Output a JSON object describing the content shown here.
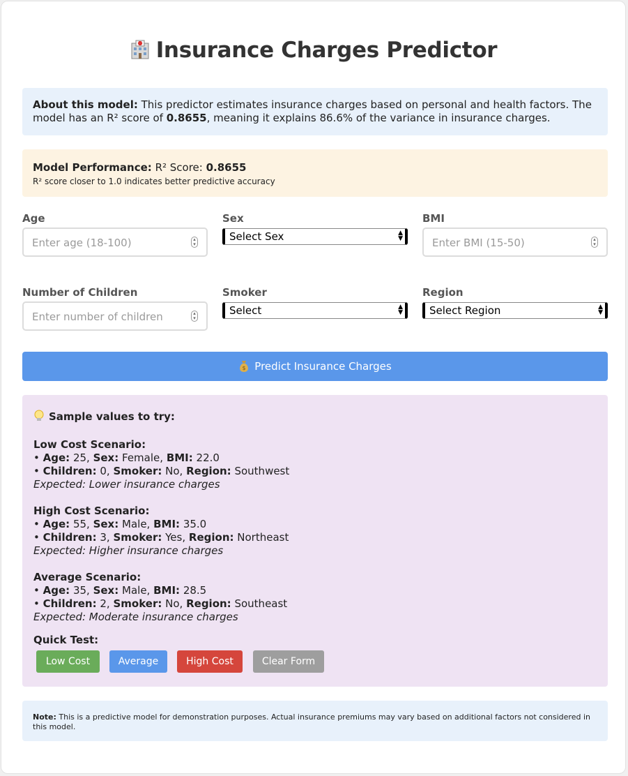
{
  "title": "Insurance Charges Predictor",
  "about": {
    "label": "About this model:",
    "text_1": " This predictor estimates insurance charges based on personal and health factors. The model has an R² score of ",
    "score": "0.8655",
    "text_2": ", meaning it explains 86.6% of the variance in insurance charges."
  },
  "performance": {
    "label": "Model Performance:",
    "score_label": " R² Score: ",
    "score": "0.8655",
    "note": "R² score closer to 1.0 indicates better predictive accuracy"
  },
  "form": {
    "age": {
      "label": "Age",
      "placeholder": "Enter age (18-100)"
    },
    "sex": {
      "label": "Sex",
      "value": "Select Sex"
    },
    "bmi": {
      "label": "BMI",
      "placeholder": "Enter BMI (15-50)"
    },
    "children": {
      "label": "Number of Children",
      "placeholder": "Enter number of children"
    },
    "smoker": {
      "label": "Smoker",
      "value": "Select"
    },
    "region": {
      "label": "Region",
      "value": "Select Region"
    }
  },
  "predict_button": "Predict Insurance Charges",
  "samples": {
    "header": "Sample values to try:",
    "scenarios": [
      {
        "title": "Low Cost Scenario:",
        "age": "25",
        "sex": "Female",
        "bmi": "22.0",
        "children": "0",
        "smoker": "No",
        "region": "Southwest",
        "expected": "Expected: Lower insurance charges"
      },
      {
        "title": "High Cost Scenario:",
        "age": "55",
        "sex": "Male",
        "bmi": "35.0",
        "children": "3",
        "smoker": "Yes",
        "region": "Northeast",
        "expected": "Expected: Higher insurance charges"
      },
      {
        "title": "Average Scenario:",
        "age": "35",
        "sex": "Male",
        "bmi": "28.5",
        "children": "2",
        "smoker": "No",
        "region": "Southeast",
        "expected": "Expected: Moderate insurance charges"
      }
    ],
    "keys": {
      "age": "Age:",
      "sex": "Sex:",
      "bmi": "BMI:",
      "children": "Children:",
      "smoker": "Smoker:",
      "region": "Region:"
    },
    "quick_test_label": "Quick Test:",
    "buttons": {
      "low": "Low Cost",
      "average": "Average",
      "high": "High Cost",
      "clear": "Clear Form"
    }
  },
  "note": {
    "label": "Note:",
    "text": " This is a predictive model for demonstration purposes. Actual insurance premiums may vary based on additional factors not considered in this model."
  },
  "colors": {
    "primary": "#5a97ea",
    "low": "#6aac5a",
    "average": "#5a97ea",
    "high": "#d5463c",
    "clear": "#9e9e9e"
  },
  "icons": {
    "title": "hospital-icon",
    "predict": "money-bag-icon",
    "samples": "light-bulb-icon"
  }
}
